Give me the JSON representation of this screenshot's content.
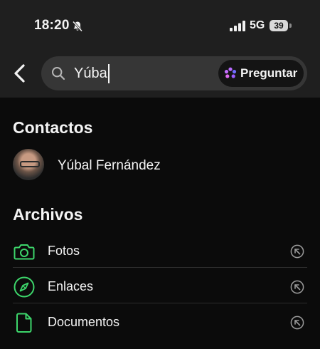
{
  "status_bar": {
    "time": "18:20",
    "network": "5G",
    "battery": "39"
  },
  "search": {
    "query": "Yúbal",
    "ask_label": "Preguntar"
  },
  "contacts": {
    "title": "Contactos",
    "items": [
      {
        "name": "Yúbal Fernández"
      }
    ]
  },
  "files": {
    "title": "Archivos",
    "items": [
      {
        "label": "Fotos",
        "icon": "camera-icon"
      },
      {
        "label": "Enlaces",
        "icon": "compass-icon"
      },
      {
        "label": "Documentos",
        "icon": "document-icon"
      }
    ]
  },
  "colors": {
    "accent": "#3dd66b",
    "background": "#0b0b0b",
    "header": "#1f1f1f"
  }
}
